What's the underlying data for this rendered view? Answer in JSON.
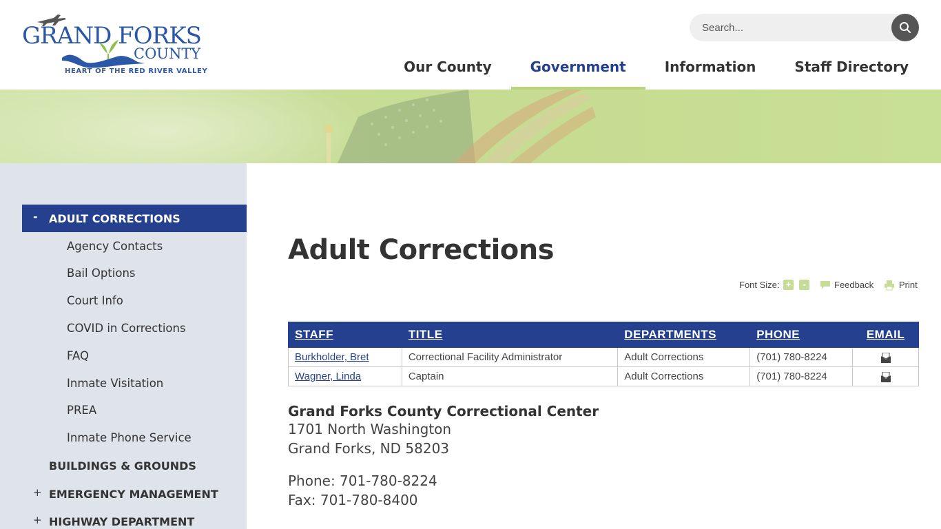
{
  "logo": {
    "line1": "GRAND FORKS",
    "line2": "COUNTY",
    "tagline_prefix": "HEART OF THE ",
    "tagline_highlight": "RED RIVER VALLEY"
  },
  "search": {
    "placeholder": "Search..."
  },
  "nav": {
    "items": [
      {
        "label": "Our County",
        "active": false
      },
      {
        "label": "Government",
        "active": true
      },
      {
        "label": "Information",
        "active": false
      },
      {
        "label": "Staff Directory",
        "active": false
      }
    ]
  },
  "sidebar": {
    "active": {
      "toggle": "-",
      "label": "ADULT CORRECTIONS"
    },
    "sub_items": [
      "Agency Contacts",
      "Bail Options",
      "Court Info",
      "COVID in Corrections",
      "FAQ",
      "Inmate Visitation",
      "PREA",
      "Inmate Phone Service"
    ],
    "top_items": [
      {
        "label": "BUILDINGS & GROUNDS",
        "toggle": ""
      },
      {
        "label": "EMERGENCY MANAGEMENT",
        "toggle": "+"
      },
      {
        "label": "HIGHWAY DEPARTMENT",
        "toggle": "+"
      }
    ]
  },
  "page": {
    "title": "Adult Corrections"
  },
  "tools": {
    "font_size_label": "Font Size:",
    "increase": "+",
    "decrease": "-",
    "feedback": "Feedback",
    "print": "Print"
  },
  "staff_table": {
    "headers": {
      "staff": "STAFF",
      "title": "TITLE",
      "departments": "DEPARTMENTS",
      "phone": "PHONE",
      "email": "EMAIL"
    },
    "rows": [
      {
        "name": "Burkholder, Bret",
        "title": "Correctional Facility Administrator",
        "department": "Adult Corrections",
        "phone": "(701) 780-8224"
      },
      {
        "name": "Wagner, Linda",
        "title": "Captain",
        "department": "Adult Corrections",
        "phone": "(701) 780-8224"
      }
    ]
  },
  "contact": {
    "facility": "Grand Forks County Correctional Center",
    "street": "1701 North Washington",
    "city": "Grand Forks, ND 58203",
    "phone": "Phone: 701-780-8224",
    "fax": "Fax: 701-780-8400"
  },
  "colors": {
    "brand_blue": "#24408e",
    "accent_green": "#b9d47e",
    "sidebar_bg": "#dfe4ea"
  }
}
